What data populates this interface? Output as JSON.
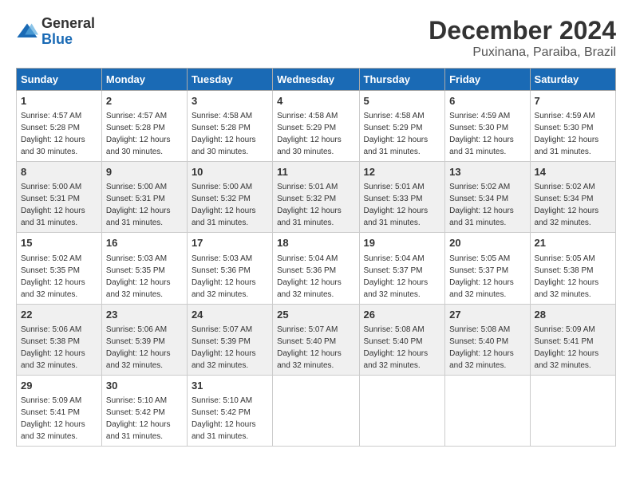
{
  "logo": {
    "general": "General",
    "blue": "Blue"
  },
  "title": "December 2024",
  "location": "Puxinana, Paraiba, Brazil",
  "weekdays": [
    "Sunday",
    "Monday",
    "Tuesday",
    "Wednesday",
    "Thursday",
    "Friday",
    "Saturday"
  ],
  "weeks": [
    [
      {
        "day": 1,
        "sunrise": "4:57 AM",
        "sunset": "5:28 PM",
        "daylight": "12 hours and 30 minutes."
      },
      {
        "day": 2,
        "sunrise": "4:57 AM",
        "sunset": "5:28 PM",
        "daylight": "12 hours and 30 minutes."
      },
      {
        "day": 3,
        "sunrise": "4:58 AM",
        "sunset": "5:28 PM",
        "daylight": "12 hours and 30 minutes."
      },
      {
        "day": 4,
        "sunrise": "4:58 AM",
        "sunset": "5:29 PM",
        "daylight": "12 hours and 30 minutes."
      },
      {
        "day": 5,
        "sunrise": "4:58 AM",
        "sunset": "5:29 PM",
        "daylight": "12 hours and 31 minutes."
      },
      {
        "day": 6,
        "sunrise": "4:59 AM",
        "sunset": "5:30 PM",
        "daylight": "12 hours and 31 minutes."
      },
      {
        "day": 7,
        "sunrise": "4:59 AM",
        "sunset": "5:30 PM",
        "daylight": "12 hours and 31 minutes."
      }
    ],
    [
      {
        "day": 8,
        "sunrise": "5:00 AM",
        "sunset": "5:31 PM",
        "daylight": "12 hours and 31 minutes."
      },
      {
        "day": 9,
        "sunrise": "5:00 AM",
        "sunset": "5:31 PM",
        "daylight": "12 hours and 31 minutes."
      },
      {
        "day": 10,
        "sunrise": "5:00 AM",
        "sunset": "5:32 PM",
        "daylight": "12 hours and 31 minutes."
      },
      {
        "day": 11,
        "sunrise": "5:01 AM",
        "sunset": "5:32 PM",
        "daylight": "12 hours and 31 minutes."
      },
      {
        "day": 12,
        "sunrise": "5:01 AM",
        "sunset": "5:33 PM",
        "daylight": "12 hours and 31 minutes."
      },
      {
        "day": 13,
        "sunrise": "5:02 AM",
        "sunset": "5:34 PM",
        "daylight": "12 hours and 31 minutes."
      },
      {
        "day": 14,
        "sunrise": "5:02 AM",
        "sunset": "5:34 PM",
        "daylight": "12 hours and 32 minutes."
      }
    ],
    [
      {
        "day": 15,
        "sunrise": "5:02 AM",
        "sunset": "5:35 PM",
        "daylight": "12 hours and 32 minutes."
      },
      {
        "day": 16,
        "sunrise": "5:03 AM",
        "sunset": "5:35 PM",
        "daylight": "12 hours and 32 minutes."
      },
      {
        "day": 17,
        "sunrise": "5:03 AM",
        "sunset": "5:36 PM",
        "daylight": "12 hours and 32 minutes."
      },
      {
        "day": 18,
        "sunrise": "5:04 AM",
        "sunset": "5:36 PM",
        "daylight": "12 hours and 32 minutes."
      },
      {
        "day": 19,
        "sunrise": "5:04 AM",
        "sunset": "5:37 PM",
        "daylight": "12 hours and 32 minutes."
      },
      {
        "day": 20,
        "sunrise": "5:05 AM",
        "sunset": "5:37 PM",
        "daylight": "12 hours and 32 minutes."
      },
      {
        "day": 21,
        "sunrise": "5:05 AM",
        "sunset": "5:38 PM",
        "daylight": "12 hours and 32 minutes."
      }
    ],
    [
      {
        "day": 22,
        "sunrise": "5:06 AM",
        "sunset": "5:38 PM",
        "daylight": "12 hours and 32 minutes."
      },
      {
        "day": 23,
        "sunrise": "5:06 AM",
        "sunset": "5:39 PM",
        "daylight": "12 hours and 32 minutes."
      },
      {
        "day": 24,
        "sunrise": "5:07 AM",
        "sunset": "5:39 PM",
        "daylight": "12 hours and 32 minutes."
      },
      {
        "day": 25,
        "sunrise": "5:07 AM",
        "sunset": "5:40 PM",
        "daylight": "12 hours and 32 minutes."
      },
      {
        "day": 26,
        "sunrise": "5:08 AM",
        "sunset": "5:40 PM",
        "daylight": "12 hours and 32 minutes."
      },
      {
        "day": 27,
        "sunrise": "5:08 AM",
        "sunset": "5:40 PM",
        "daylight": "12 hours and 32 minutes."
      },
      {
        "day": 28,
        "sunrise": "5:09 AM",
        "sunset": "5:41 PM",
        "daylight": "12 hours and 32 minutes."
      }
    ],
    [
      {
        "day": 29,
        "sunrise": "5:09 AM",
        "sunset": "5:41 PM",
        "daylight": "12 hours and 32 minutes."
      },
      {
        "day": 30,
        "sunrise": "5:10 AM",
        "sunset": "5:42 PM",
        "daylight": "12 hours and 31 minutes."
      },
      {
        "day": 31,
        "sunrise": "5:10 AM",
        "sunset": "5:42 PM",
        "daylight": "12 hours and 31 minutes."
      },
      null,
      null,
      null,
      null
    ]
  ]
}
